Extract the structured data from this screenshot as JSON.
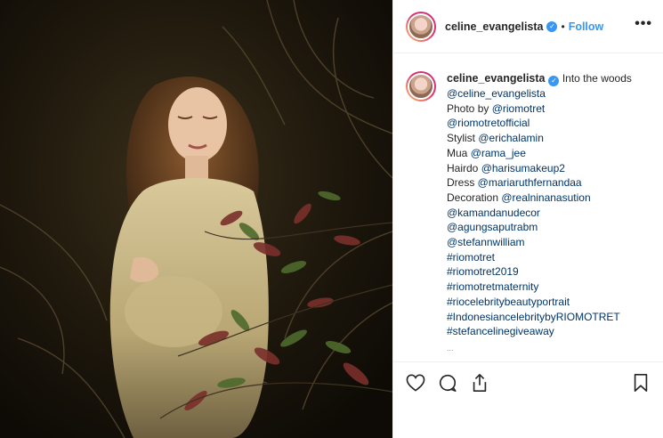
{
  "post": {
    "username": "celine_evangelista",
    "follow_label": "Follow",
    "separator": "•",
    "more_label": "•••",
    "caption_first": "Into the woods",
    "caption_lines": [
      {
        "pre": "",
        "link": "@celine_evangelista",
        "type": "mention"
      },
      {
        "pre": "Photo by ",
        "link": "@riomotret",
        "type": "mention"
      },
      {
        "pre": "",
        "link": "@riomotretofficial",
        "type": "mention"
      },
      {
        "pre": "Stylist ",
        "link": "@erichalamin",
        "type": "mention"
      },
      {
        "pre": "Mua ",
        "link": "@rama_jee",
        "type": "mention"
      },
      {
        "pre": "Hairdo ",
        "link": "@harisumakeup2",
        "type": "mention"
      },
      {
        "pre": "Dress ",
        "link": "@mariaruthfernandaa",
        "type": "mention"
      },
      {
        "pre": "Decoration ",
        "link": "@realninanasution",
        "type": "mention"
      },
      {
        "pre": "",
        "link": "@kamandanudecor",
        "type": "mention"
      },
      {
        "pre": "",
        "link": "@agungsaputrabm",
        "type": "mention"
      },
      {
        "pre": "",
        "link": "@stefannwilliam",
        "type": "mention"
      },
      {
        "pre": "",
        "link": "#riomotret",
        "type": "hashtag"
      },
      {
        "pre": "",
        "link": "#riomotret2019",
        "type": "hashtag"
      },
      {
        "pre": "",
        "link": "#riomotretmaternity",
        "type": "hashtag"
      },
      {
        "pre": "",
        "link": "#riocelebritybeautyportrait",
        "type": "hashtag"
      },
      {
        "pre": "",
        "link": "#IndonesiancelebritybyRIOMOTRET",
        "type": "hashtag"
      },
      {
        "pre": "",
        "link": "#stefancelinegiveaway",
        "type": "hashtag"
      }
    ]
  },
  "icons": {
    "like": "heart-icon",
    "comment": "comment-icon",
    "share": "share-icon",
    "save": "bookmark-icon",
    "verified": "verified-badge-icon"
  },
  "colors": {
    "link": "#003569",
    "follow": "#3897f0",
    "verified": "#3897f0"
  }
}
